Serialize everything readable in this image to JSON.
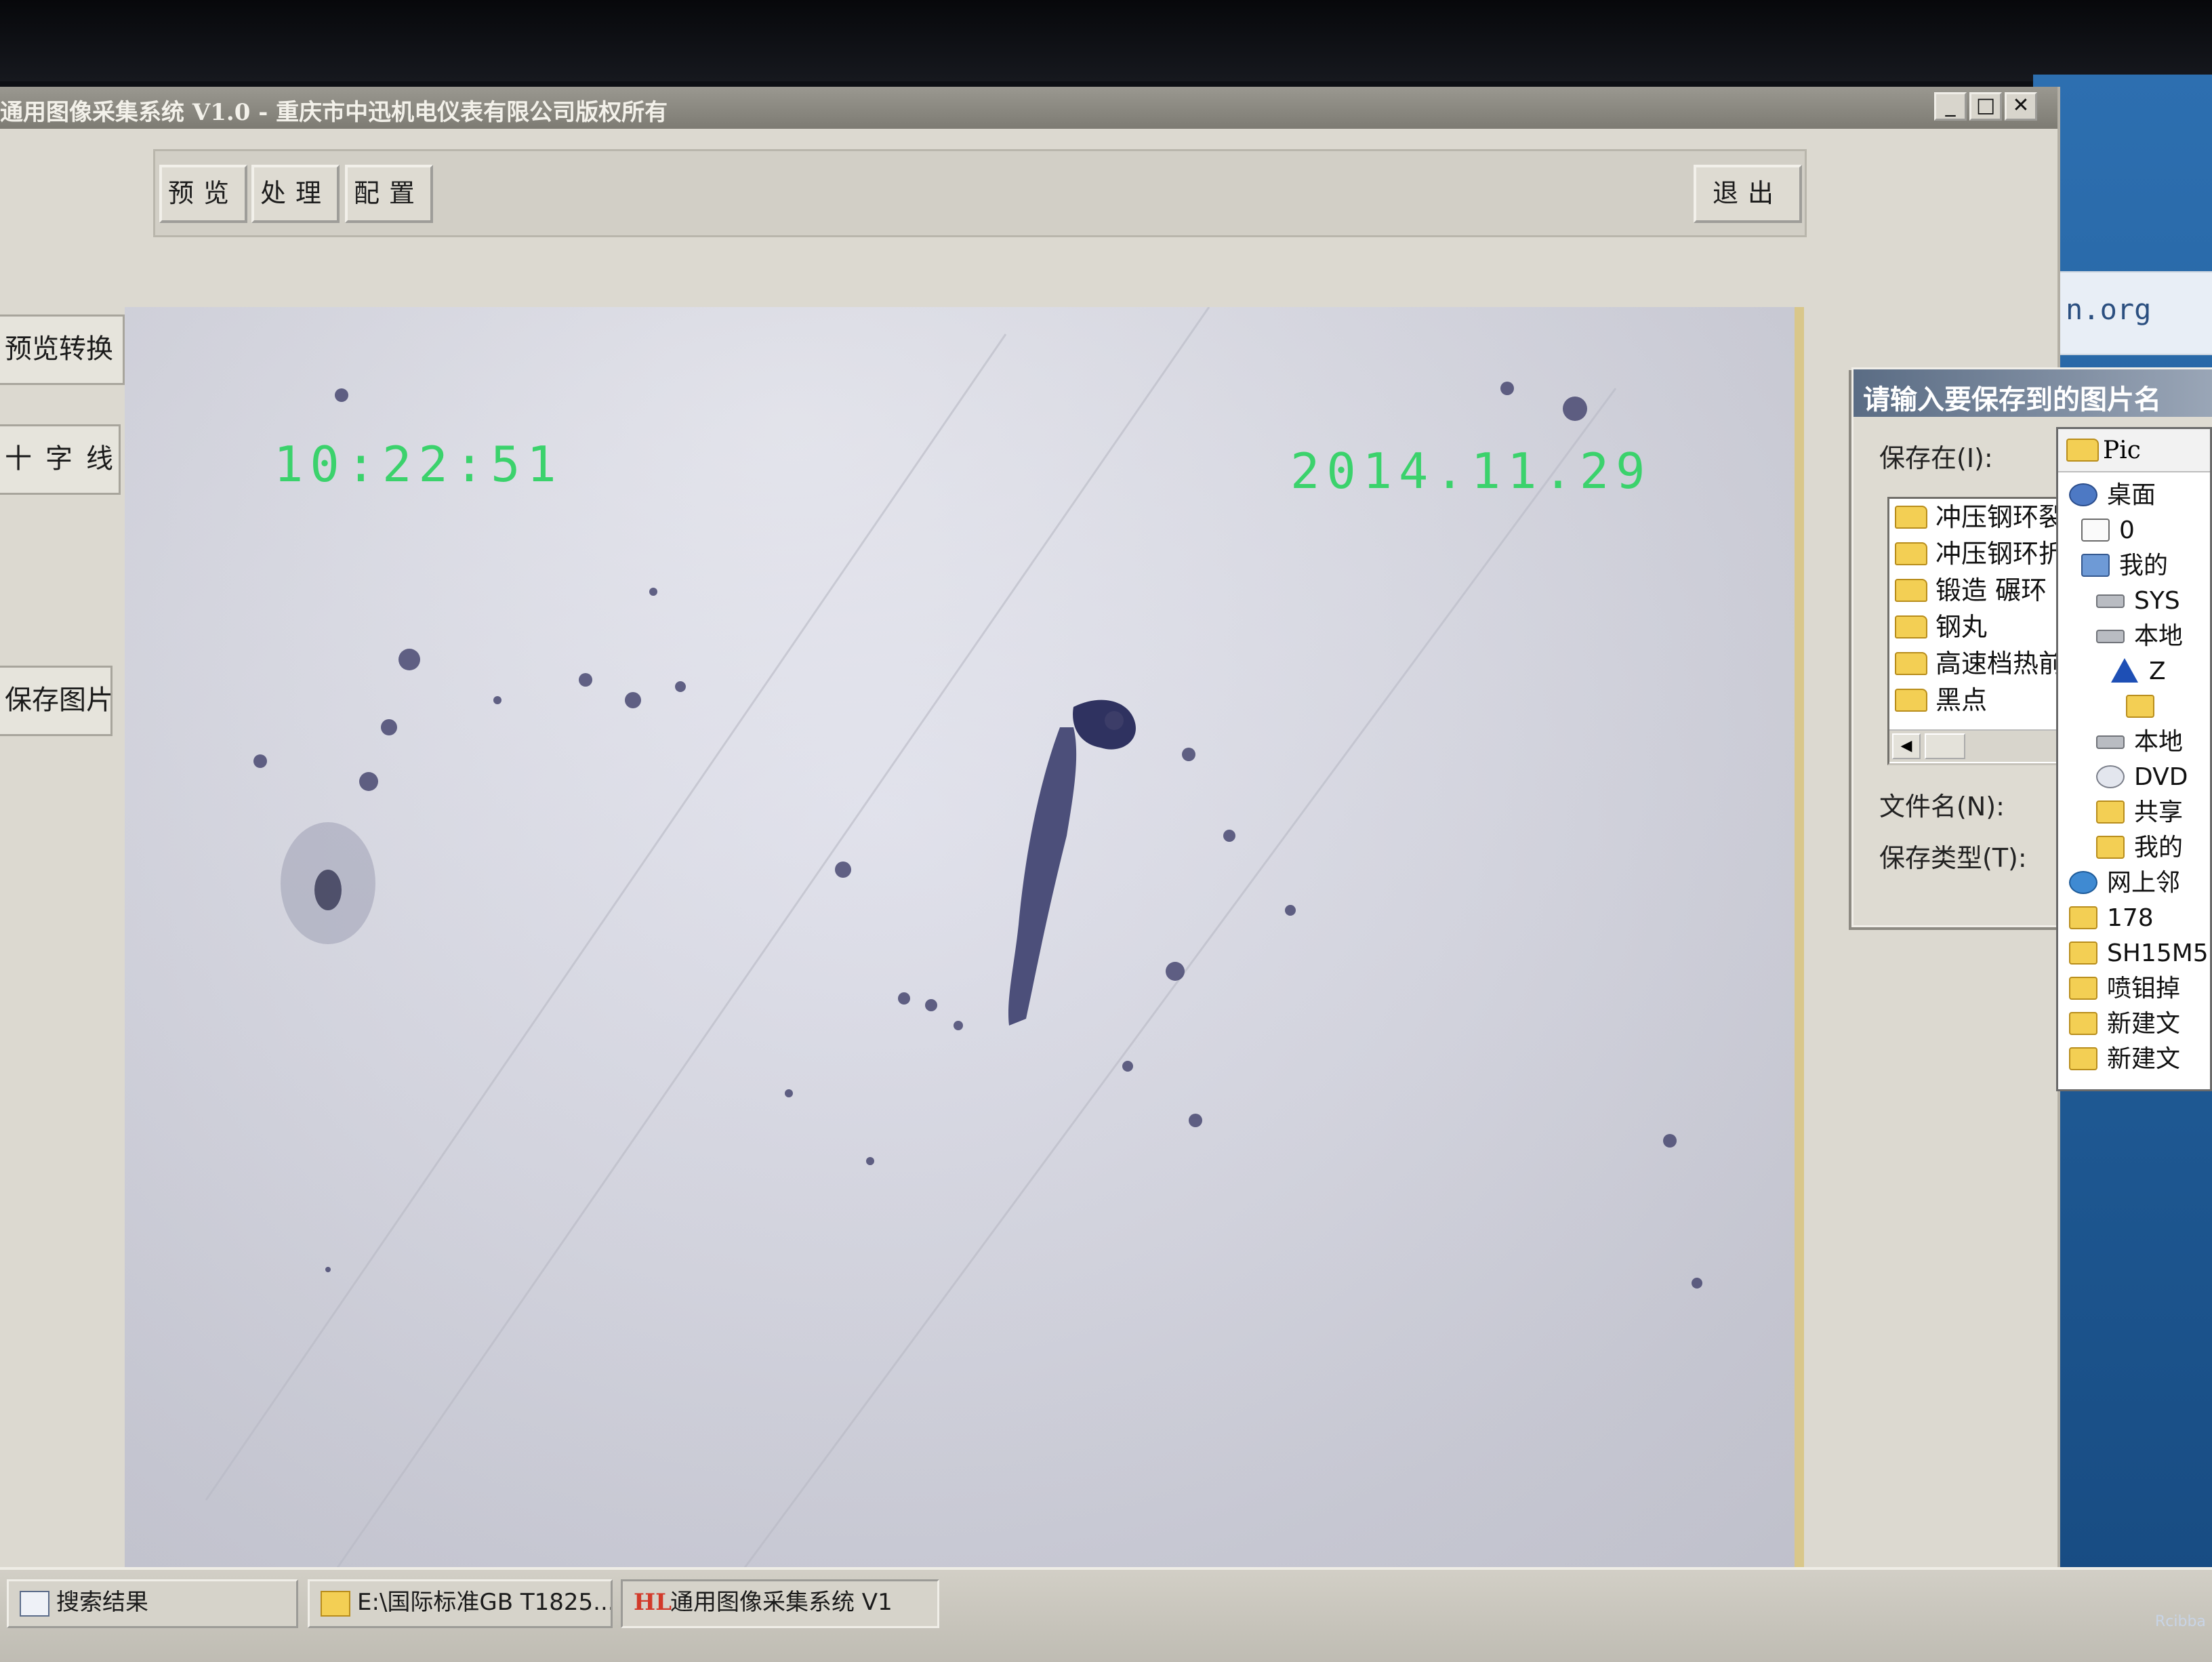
{
  "window": {
    "title": "通用图像采集系统 V1.0 - 重庆市中迅机电仪表有限公司版权所有",
    "controls": {
      "minimize": "_",
      "maximize": "□",
      "close": "✕"
    }
  },
  "toolbar": {
    "preview": "预览",
    "process": "处理",
    "config": "配置",
    "exit": "退出"
  },
  "side_buttons": {
    "preview_convert": "预览转换",
    "crosshair": "十字线",
    "save_image": "保存图片"
  },
  "preview": {
    "osd_time": "10:22:51",
    "osd_date": "2014.11.29"
  },
  "desktop": {
    "snippet_text": "n.org",
    "watermark": "Rcibba"
  },
  "save_dialog": {
    "title": "请输入要保存到的图片名",
    "save_in_label": "保存在(I):",
    "file_name_label": "文件名(N):",
    "file_type_label": "保存类型(T):",
    "folders": [
      "冲压钢环裂",
      "冲压钢环折",
      "锻造 碾环",
      "钢丸",
      "高速档热前",
      "黑点"
    ],
    "scroll_left_icon": "◀"
  },
  "save_in_dropdown": {
    "current": "Pic",
    "items": [
      {
        "label": "桌面",
        "icon": "desktop-icon"
      },
      {
        "label": "0",
        "icon": "documents-icon"
      },
      {
        "label": "我的",
        "icon": "computer-icon"
      },
      {
        "label": "SYS",
        "icon": "drive-icon"
      },
      {
        "label": "本地",
        "icon": "drive-icon"
      },
      {
        "label": "Z",
        "icon": "warning-icon"
      },
      {
        "label": "",
        "icon": "folder-icon"
      },
      {
        "label": "本地",
        "icon": "drive-icon"
      },
      {
        "label": "DVD",
        "icon": "dvd-icon"
      },
      {
        "label": "共享",
        "icon": "folder-icon"
      },
      {
        "label": "我的",
        "icon": "folder-icon"
      },
      {
        "label": "网上邻",
        "icon": "network-icon"
      },
      {
        "label": "178",
        "icon": "folder-icon"
      },
      {
        "label": "SH15M5",
        "icon": "folder-icon"
      },
      {
        "label": "喷钼掉",
        "icon": "folder-icon"
      },
      {
        "label": "新建文",
        "icon": "folder-icon"
      },
      {
        "label": "新建文",
        "icon": "folder-icon"
      }
    ]
  },
  "taskbar": {
    "items": [
      {
        "label": "搜索结果"
      },
      {
        "label": "E:\\国际标准GB T1825..."
      },
      {
        "badge": "HL",
        "label": "通用图像采集系统 V1"
      }
    ]
  },
  "colors": {
    "osd_green": "#3bd26c",
    "titlebar": "#8a887f",
    "dialog_title": "#5a6c84",
    "desktop_blue": "#2d6fb0"
  }
}
